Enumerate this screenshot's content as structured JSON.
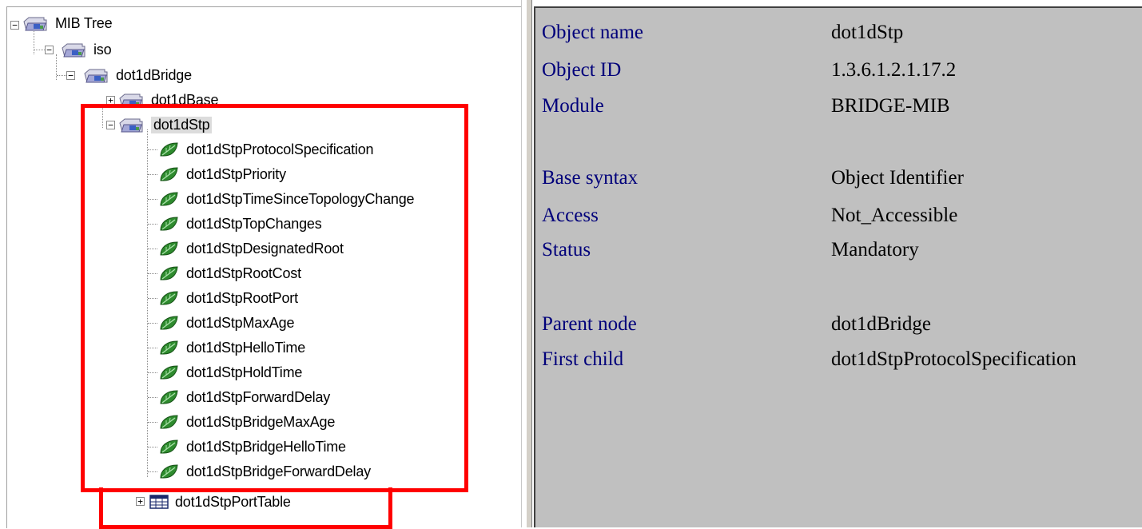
{
  "tree": {
    "root": {
      "label": "MIB Tree"
    },
    "iso": {
      "label": "iso"
    },
    "dot1dBridge": {
      "label": "dot1dBridge"
    },
    "dot1dBase": {
      "label": "dot1dBase"
    },
    "dot1dStp": {
      "label": "dot1dStp"
    },
    "stp_leaves": [
      "dot1dStpProtocolSpecification",
      "dot1dStpPriority",
      "dot1dStpTimeSinceTopologyChange",
      "dot1dStpTopChanges",
      "dot1dStpDesignatedRoot",
      "dot1dStpRootCost",
      "dot1dStpRootPort",
      "dot1dStpMaxAge",
      "dot1dStpHelloTime",
      "dot1dStpHoldTime",
      "dot1dStpForwardDelay",
      "dot1dStpBridgeMaxAge",
      "dot1dStpBridgeHelloTime",
      "dot1dStpBridgeForwardDelay"
    ],
    "port_table": {
      "label": "dot1dStpPortTable"
    }
  },
  "details": {
    "object_name": {
      "label": "Object name",
      "value": "dot1dStp"
    },
    "object_id": {
      "label": "Object ID",
      "value": "1.3.6.1.2.1.17.2"
    },
    "module": {
      "label": "Module",
      "value": "BRIDGE-MIB"
    },
    "base_syntax": {
      "label": "Base syntax",
      "value": "Object Identifier"
    },
    "access": {
      "label": "Access",
      "value": "Not_Accessible"
    },
    "status": {
      "label": "Status",
      "value": "Mandatory"
    },
    "parent_node": {
      "label": "Parent node",
      "value": "dot1dBridge"
    },
    "first_child": {
      "label": "First child",
      "value": "dot1dStpProtocolSpecification"
    }
  },
  "icons": {
    "folder": "folder-icon",
    "leaf": "leaf-icon",
    "table": "table-icon"
  },
  "colors": {
    "highlight": "#ff0000",
    "details_background": "#c0c0c0",
    "detail_label": "#00007a",
    "leaf_green": "#2e8b2e"
  }
}
